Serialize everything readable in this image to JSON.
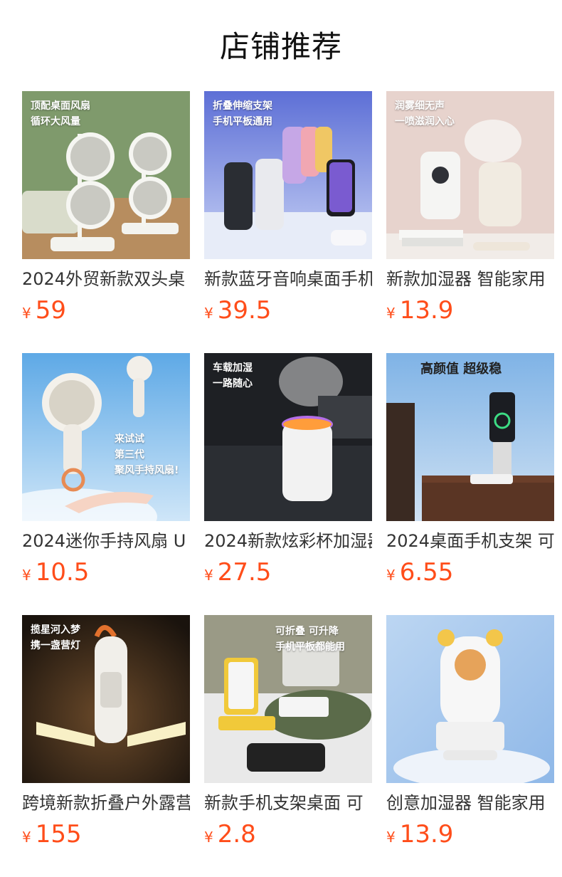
{
  "page": {
    "title": "店铺推荐"
  },
  "currency": "¥",
  "products": [
    {
      "name": "2024外贸新款双头桌",
      "price": "59",
      "img_text": "顶配桌面风扇\n循环大风量",
      "icon": "dual-desk-fan"
    },
    {
      "name": "新款蓝牙音响桌面手机",
      "price": "39.5",
      "img_text": "折叠伸缩支架\n手机平板通用",
      "icon": "bluetooth-speaker-stand"
    },
    {
      "name": "新款加湿器 智能家用",
      "price": "13.9",
      "img_text": "润雾细无声\n一喷滋润入心",
      "icon": "humidifier"
    },
    {
      "name": "2024迷你手持风扇 U",
      "price": "10.5",
      "img_text": "来试试\n第三代\n聚风手持风扇!",
      "icon": "handheld-fan"
    },
    {
      "name": "2024新款炫彩杯加湿器",
      "price": "27.5",
      "img_text": "车载加湿\n一路随心",
      "icon": "car-humidifier"
    },
    {
      "name": "2024桌面手机支架 可",
      "price": "6.55",
      "img_text": "高颜值 超级稳",
      "icon": "phone-stand"
    },
    {
      "name": "跨境新款折叠户外露营",
      "price": "155",
      "img_text": "揽星河入梦\n携一盏营灯",
      "icon": "camping-lamp"
    },
    {
      "name": "新款手机支架桌面 可",
      "price": "2.8",
      "img_text": "可折叠 可升降\n手机平板都能用",
      "icon": "folding-phone-stand"
    },
    {
      "name": "创意加湿器 智能家用",
      "price": "13.9",
      "img_text": "",
      "icon": "bear-humidifier"
    }
  ]
}
